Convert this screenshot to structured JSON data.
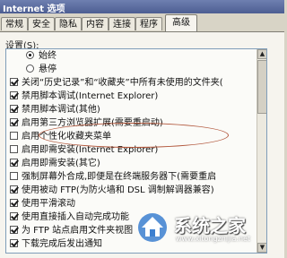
{
  "window": {
    "title": "Internet 选项"
  },
  "tabs": [
    {
      "label": "常规",
      "active": false
    },
    {
      "label": "安全",
      "active": false
    },
    {
      "label": "隐私",
      "active": false
    },
    {
      "label": "内容",
      "active": false
    },
    {
      "label": "连接",
      "active": false
    },
    {
      "label": "程序",
      "active": false
    },
    {
      "label": "高级",
      "active": true
    }
  ],
  "settings": {
    "label": "设置(S):",
    "items": [
      {
        "type": "radio",
        "checked": true,
        "label": "始终"
      },
      {
        "type": "radio",
        "checked": false,
        "label": "悬停"
      },
      {
        "type": "checkbox",
        "checked": true,
        "label": "关闭“历史记录”和“收藏夹”中所有未使用的文件夹("
      },
      {
        "type": "checkbox",
        "checked": true,
        "label": "禁用脚本调试(Internet Explorer)"
      },
      {
        "type": "checkbox",
        "checked": true,
        "label": "禁用脚本调试(其他)"
      },
      {
        "type": "checkbox",
        "checked": true,
        "label": "启用第三方浏览器扩展(需要重启动)"
      },
      {
        "type": "checkbox",
        "checked": false,
        "label": "启用个性化收藏夹菜单"
      },
      {
        "type": "checkbox",
        "checked": false,
        "label": "启用即需安装(Internet Explorer)"
      },
      {
        "type": "checkbox",
        "checked": true,
        "label": "启用即需安装(其它)"
      },
      {
        "type": "checkbox",
        "checked": false,
        "label": "强制屏幕外合成,即便是在终端服务器下(需要重启"
      },
      {
        "type": "checkbox",
        "checked": true,
        "label": "使用被动 FTP(为防火墙和 DSL 调制解调器兼容)"
      },
      {
        "type": "checkbox",
        "checked": true,
        "label": "使用平滑滚动"
      },
      {
        "type": "checkbox",
        "checked": true,
        "label": "使用直接插入自动完成功能"
      },
      {
        "type": "checkbox",
        "checked": true,
        "label": "为 FTP 站点启用文件夹视图"
      },
      {
        "type": "checkbox",
        "checked": true,
        "label": "下载完成后发出通知"
      }
    ]
  },
  "watermark": {
    "text": "系统之家",
    "url": "www.xitongzhijia.net"
  },
  "colors": {
    "annotation": "#b2583d",
    "titlebar": "#4d5e92"
  }
}
